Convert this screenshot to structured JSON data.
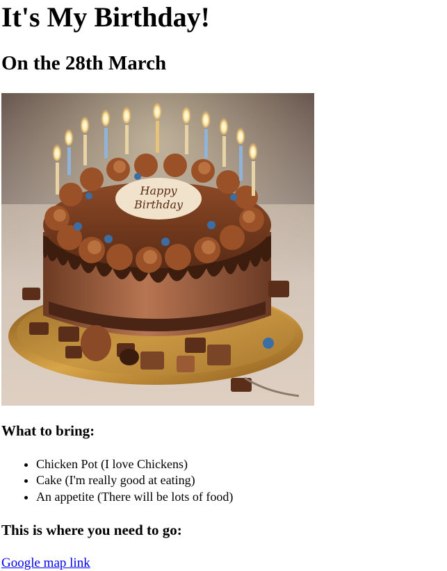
{
  "page": {
    "title": "It's My Birthday!",
    "subtitle": "On the 28th March"
  },
  "image": {
    "cake_text_line1": "Happy",
    "cake_text_line2": "Birthday"
  },
  "bring": {
    "heading": "What to bring:",
    "items": [
      {
        "label": "Chicken Pot (I love Chickens)"
      },
      {
        "label": "Cake (I'm really good at eating)"
      },
      {
        "label": "An appetite (There will be lots of food)"
      }
    ]
  },
  "directions": {
    "heading": "This is where you need to go:",
    "link_label": "Google map link"
  },
  "colors": {
    "link": "#0000ee",
    "text": "#000000",
    "background": "#ffffff"
  }
}
